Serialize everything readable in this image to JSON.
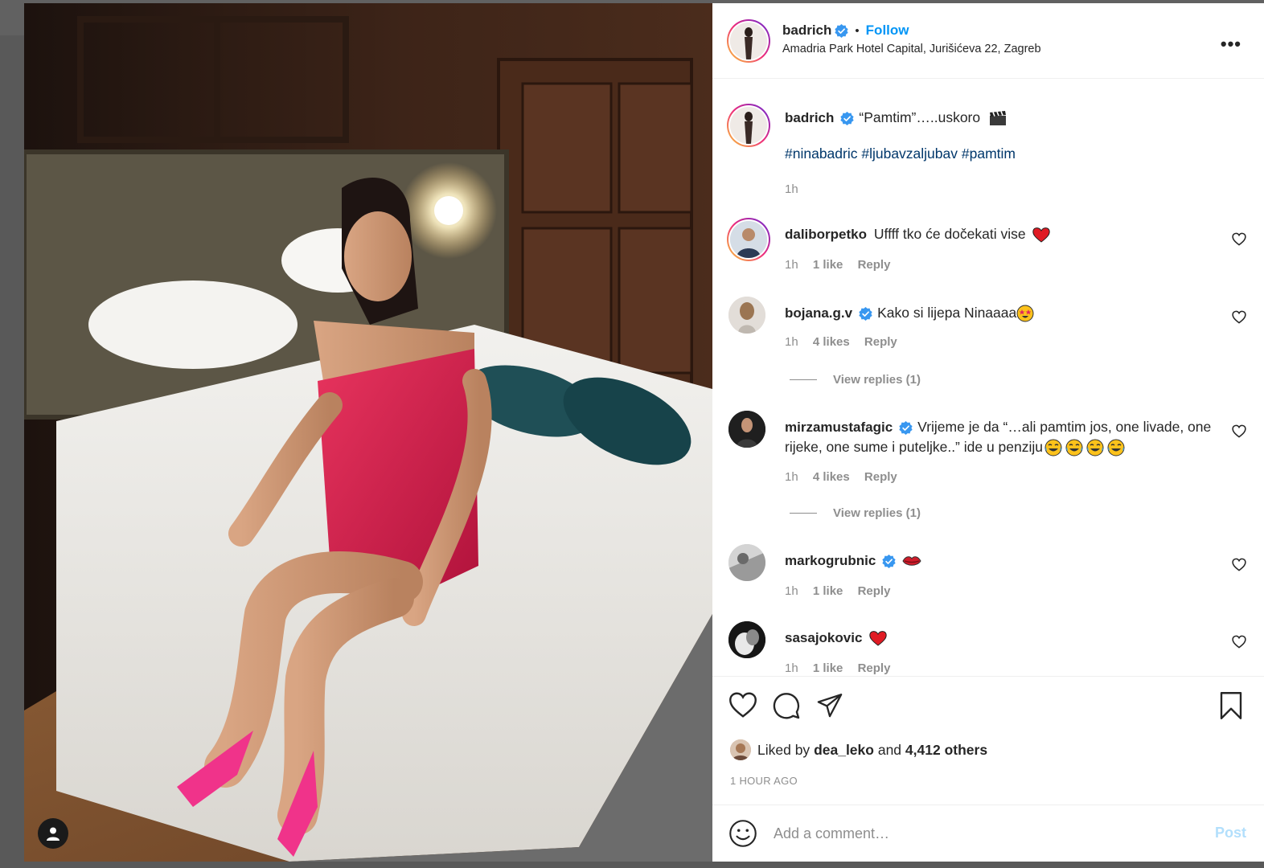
{
  "post": {
    "username": "badrich",
    "follow_label": "Follow",
    "dot": "•",
    "location": "Amadria Park Hotel Capital, Jurišićeva 22, Zagreb",
    "more": "•••"
  },
  "caption": {
    "username": "badrich",
    "text": "“Pamtim”…..uskoro",
    "emoji_icon": "clapperboard-icon",
    "hashtags": "#ninabadric #ljubavzaljubav #pamtim",
    "time": "1h"
  },
  "comments": [
    {
      "username": "daliborpetko",
      "verified": false,
      "text": "Uffff tko će dočekati vise",
      "emoji": "red-heart",
      "time": "1h",
      "likes": "1 like",
      "reply": "Reply"
    },
    {
      "username": "bojana.g.v",
      "verified": true,
      "text": "Kako si lijepa Ninaaaa",
      "emoji": "star-struck",
      "time": "1h",
      "likes": "4 likes",
      "reply": "Reply",
      "view_replies": "View replies (1)"
    },
    {
      "username": "mirzamustafagic",
      "verified": true,
      "text": "Vrijeme je da “…ali pamtim jos, one livade, one rijeke, one sume i puteljke..” ide u penziju",
      "emoji": "tears-of-joy x4",
      "time": "1h",
      "likes": "4 likes",
      "reply": "Reply",
      "view_replies": "View replies (1)"
    },
    {
      "username": "markogrubnic",
      "verified": true,
      "text": "",
      "emoji": "kiss-mark",
      "time": "1h",
      "likes": "1 like",
      "reply": "Reply"
    },
    {
      "username": "sasajokovic",
      "verified": false,
      "text": "",
      "emoji": "red-heart",
      "time": "1h",
      "likes": "1 like",
      "reply": "Reply"
    }
  ],
  "actions": {
    "liked_by_prefix": "Liked by",
    "liked_by_user": "dea_leko",
    "and": "and",
    "others": "4,412 others",
    "time_ago": "1 HOUR AGO"
  },
  "add_comment": {
    "placeholder": "Add a comment…",
    "post_label": "Post"
  },
  "colors": {
    "accent_blue": "#0095f6",
    "hashtag": "#00376b",
    "muted": "#8e8e8e",
    "post_disabled": "#b2dffc",
    "dress": "#d21f4a",
    "shoes": "#f0338a"
  }
}
